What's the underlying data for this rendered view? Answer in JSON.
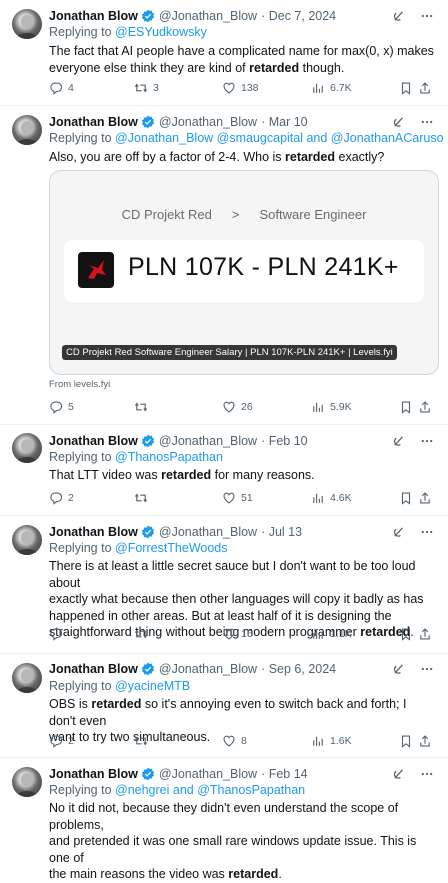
{
  "author": {
    "name": "Jonathan Blow",
    "handle": "@Jonathan_Blow"
  },
  "icons": {
    "verified": "verified-badge",
    "grok": "grok-icon",
    "more": "more-icon",
    "reply": "reply-icon",
    "retweet": "retweet-icon",
    "like": "like-icon",
    "views": "views-icon",
    "bookmark": "bookmark-icon",
    "share": "share-icon"
  },
  "colors": {
    "link": "#1d9bf0",
    "secondary": "#536471",
    "verified": "#1d9bf0"
  },
  "tweets": [
    {
      "date": "· Dec 7, 2024",
      "reply_prefix": "Replying to ",
      "reply_to": "@ESYudkowsky",
      "text_parts": [
        "The fact that AI people have a complicated name for max(0, x) makes everyone else think they are kind of ",
        "retarded",
        " though."
      ],
      "stats": {
        "replies": "4",
        "retweets": "3",
        "likes": "138",
        "views": "6.7K"
      }
    },
    {
      "date": "· Mar 10",
      "reply_prefix": "Replying to ",
      "reply_to": "@Jonathan_Blow @smaugcapital and @JonathanACaruso",
      "text_parts": [
        "Also, you are off by a factor of 2-4. Who is ",
        "retarded",
        " exactly?"
      ],
      "card": {
        "breadcrumb_company": "CD Projekt Red",
        "breadcrumb_sep": ">",
        "breadcrumb_role": "Software Engineer",
        "salary": "PLN 107K - PLN 241K+",
        "caption": "CD Projekt Red Software Engineer Salary | PLN 107K-PLN 241K+ | Levels.fyi",
        "source": "From levels.fyi"
      },
      "stats": {
        "replies": "5",
        "retweets": "",
        "likes": "26",
        "views": "5.9K"
      }
    },
    {
      "date": "· Feb 10",
      "reply_prefix": "Replying to ",
      "reply_to": "@ThanosPapathan",
      "text_parts": [
        "That LTT video was ",
        "retarded",
        " for many reasons."
      ],
      "stats": {
        "replies": "2",
        "retweets": "",
        "likes": "51",
        "views": "4.6K"
      }
    },
    {
      "date": "· Jul 13",
      "reply_prefix": "Replying to ",
      "reply_to": "@ForrestTheWoods",
      "lines": [
        "There is at least a little secret sauce but I don't want to be too loud about",
        "exactly what because then other languages will copy it badly as has",
        "happened in other areas. But at least half of it is designing the",
        "straightforward thing without being modern programmer "
      ],
      "bold": "retarded",
      "tail": ".",
      "stats": {
        "replies": "",
        "retweets": "",
        "likes": "16",
        "views": "1.1K"
      }
    },
    {
      "date": "· Sep 6, 2024",
      "reply_prefix": "Replying to ",
      "reply_to": "@yacineMTB",
      "lines": [
        "OBS is ",
        "retarded",
        " so it's annoying even to switch back and forth; I don't even",
        "want to try two simultaneous."
      ],
      "stats": {
        "replies": "2",
        "retweets": "",
        "likes": "8",
        "views": "1.6K"
      }
    },
    {
      "date": "· Feb 14",
      "reply_prefix": "Replying to ",
      "reply_to": "@nehgrei and @ThanosPapathan",
      "lines": [
        "No it did not, because they didn't even understand the scope of problems,",
        "and pretended it was one small rare windows update issue. This is one of",
        "the main reasons the video was "
      ],
      "bold": "retarded",
      "tail": "."
    }
  ]
}
